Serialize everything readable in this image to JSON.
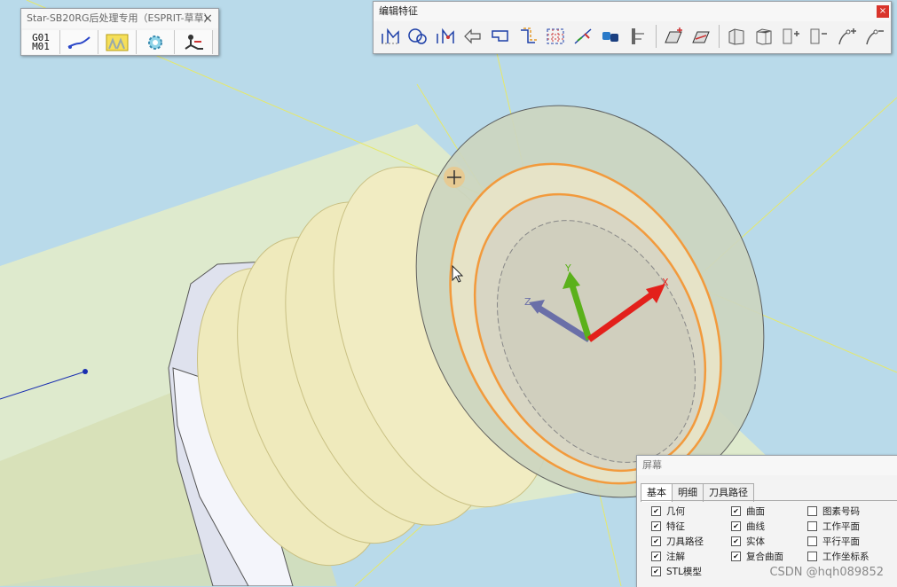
{
  "post_panel": {
    "title": "Star-SB20RG后处理专用（ESPRIT-草草）",
    "close_glyph": "×",
    "tools": [
      {
        "icon": "g01-m01-code-icon",
        "label_line1": "G01",
        "label_line2": "M01"
      },
      {
        "icon": "toolpath-curve-icon"
      },
      {
        "icon": "lighting-icon"
      },
      {
        "icon": "settings-gear-icon"
      },
      {
        "icon": "machine-operator-icon"
      }
    ]
  },
  "feature_panel": {
    "title": "编辑特征",
    "close_glyph": "×",
    "tools": [
      "edit-points-icon",
      "edit-arc-icon",
      "edit-vertex-icon",
      "reverse-direction-icon",
      "edit-profile-icon",
      "offset-icon",
      "pattern-grid-icon",
      "split-chain-icon",
      "link-features-icon",
      "trim-extend-icon",
      "surface-feature-icon",
      "surface-edit-icon",
      "solid-face-icon",
      "solid-box-icon",
      "add-face-icon",
      "remove-face-icon",
      "add-line-icon",
      "remove-line-icon"
    ]
  },
  "screen_panel": {
    "title": "屏幕",
    "tabs": [
      "基本",
      "明细",
      "刀具路径"
    ],
    "active_tab": "基本",
    "checkbox_columns": [
      [
        {
          "label": "几何",
          "checked": true
        },
        {
          "label": "特征",
          "checked": true
        },
        {
          "label": "刀具路径",
          "checked": true
        },
        {
          "label": "注解",
          "checked": true
        },
        {
          "label": "STL模型",
          "checked": true
        }
      ],
      [
        {
          "label": "曲面",
          "checked": true
        },
        {
          "label": "曲线",
          "checked": true
        },
        {
          "label": "实体",
          "checked": true
        },
        {
          "label": "复合曲面",
          "checked": true
        }
      ],
      [
        {
          "label": "图素号码",
          "checked": false
        },
        {
          "label": "工作平面",
          "checked": false
        },
        {
          "label": "平行平面",
          "checked": false
        },
        {
          "label": "工作坐标系",
          "checked": false
        }
      ]
    ]
  },
  "axes": {
    "x": "X",
    "y": "Y",
    "z": "Z"
  },
  "colors": {
    "background": "#b9daea",
    "part_fill": "#efeabc",
    "highlight_edge": "#f29a3c",
    "x_axis": "#e3201b",
    "y_axis": "#5bb11b",
    "z_axis": "#6a6fa8"
  },
  "watermark": "CSDN @hqh089852"
}
